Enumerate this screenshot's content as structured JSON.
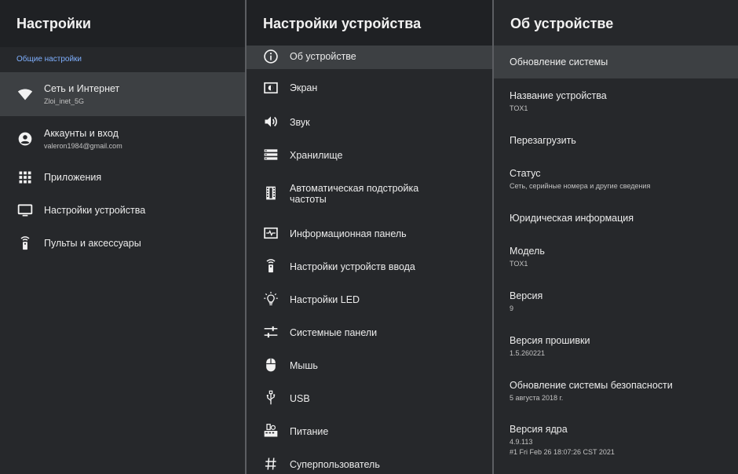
{
  "left": {
    "title": "Настройки",
    "section": "Общие настройки",
    "items": [
      {
        "label": "Сеть и Интернет",
        "sub": "Zloi_inet_5G",
        "icon": "wifi-icon"
      },
      {
        "label": "Аккаунты и вход",
        "sub": "valeron1984@gmail.com",
        "icon": "account-icon"
      },
      {
        "label": "Приложения",
        "icon": "apps-grid-icon"
      },
      {
        "label": "Настройки устройства",
        "icon": "tv-icon"
      },
      {
        "label": "Пульты и аксессуары",
        "icon": "remote-icon"
      }
    ]
  },
  "middle": {
    "title": "Настройки устройства",
    "items": [
      {
        "label": "Об устройстве",
        "icon": "info-icon"
      },
      {
        "label": "Экран",
        "icon": "screen-icon"
      },
      {
        "label": "Звук",
        "icon": "volume-icon"
      },
      {
        "label": "Хранилище",
        "icon": "storage-icon"
      },
      {
        "label": "Автоматическая подстройка",
        "label2": "частоты",
        "icon": "film-icon"
      },
      {
        "label": "Информационная панель",
        "icon": "monitor-pulse-icon"
      },
      {
        "label": "Настройки устройств ввода",
        "icon": "remote-icon"
      },
      {
        "label": "Настройки LED",
        "icon": "bulb-icon"
      },
      {
        "label": "Системные панели",
        "icon": "sliders-icon"
      },
      {
        "label": "Мышь",
        "icon": "mouse-icon"
      },
      {
        "label": "USB",
        "icon": "usb-icon"
      },
      {
        "label": "Питание",
        "icon": "power-icon"
      },
      {
        "label": "Суперпользователь",
        "icon": "hash-icon"
      }
    ]
  },
  "right": {
    "title": "Об устройстве",
    "items": [
      {
        "label": "Обновление системы"
      },
      {
        "label": "Название устройства",
        "sub": "TOX1"
      },
      {
        "label": "Перезагрузить"
      },
      {
        "label": "Статус",
        "sub": "Сеть, серийные номера и другие сведения"
      },
      {
        "label": "Юридическая информация"
      },
      {
        "label": "Модель",
        "sub": "TOX1"
      },
      {
        "label": "Версия",
        "sub": "9"
      },
      {
        "label": "Версия прошивки",
        "sub": "1.5.260221"
      },
      {
        "label": "Обновление системы безопасности",
        "sub": "5 августа 2018 г."
      },
      {
        "label": "Версия ядра",
        "sub": "4.9.113",
        "sub2": "#1 Fri Feb 26 18:07:26 CST 2021"
      }
    ]
  },
  "colors": {
    "accent": "#7fb0ff",
    "background": "#26282b",
    "selected": "#3d4043"
  }
}
